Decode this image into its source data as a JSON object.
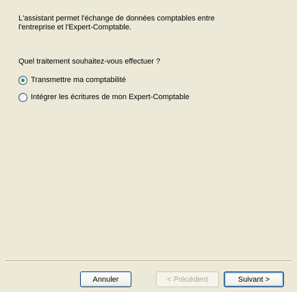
{
  "intro_text": "L'assistant permet l'échange de données comptables entre\nl'entreprise et l'Expert-Comptable.",
  "question": "Quel traitement souhaitez-vous effectuer ?",
  "options": [
    {
      "label": "Transmettre ma comptabilité",
      "selected": true
    },
    {
      "label": "Intégrer les écritures de mon Expert-Comptable",
      "selected": false
    }
  ],
  "buttons": {
    "cancel": "Annuler",
    "previous": "< Précédent",
    "next": "Suivant >"
  },
  "colors": {
    "window_bg": "#ECE9D8",
    "radio_selected": "#21A121",
    "disabled_text": "#ACA899"
  }
}
